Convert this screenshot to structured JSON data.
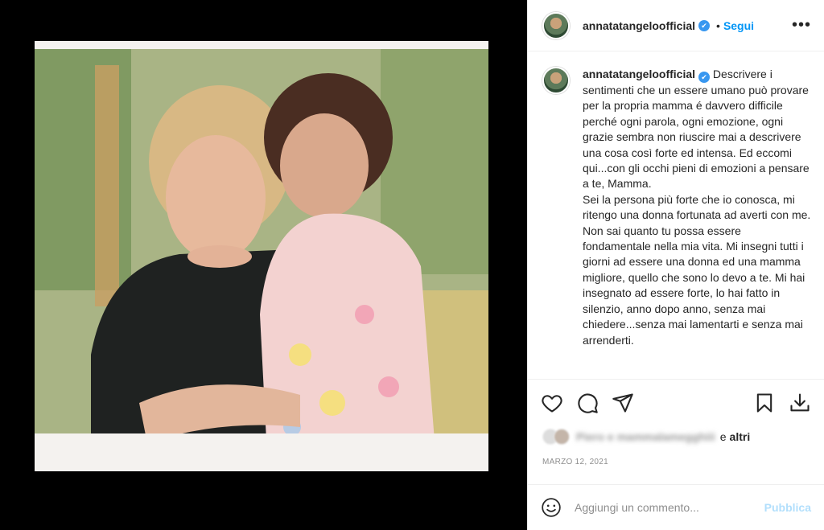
{
  "post": {
    "username": "annatatangeloofficial",
    "verified_mark": "✔",
    "dot": "•",
    "follow_label": "Segui",
    "more_label": "•••",
    "caption": "Descrivere i sentimenti che un essere umano può provare per la propria mamma é davvero difficile perché ogni parola, ogni emozione, ogni grazie sembra non riuscire mai a descrivere una cosa così forte ed intensa. Ed eccomi qui...con gli occhi pieni di emozioni a pensare a te, Mamma.\nSei la persona più forte che io conosca, mi ritengo una donna fortunata ad averti con me. Non sai quanto tu possa essere fondamentale nella mia vita. Mi insegni tutti i giorni ad essere una donna ed una mamma migliore, quello che sono lo devo a te. Mi hai insegnato ad essere forte, lo hai fatto in silenzio, anno dopo anno, senza mai chiedere...senza mai lamentarti e senza mai arrenderti."
  },
  "likes": {
    "blurred_names": "Piero e mammalamegghiii",
    "and_label": "e",
    "others_label": "altri"
  },
  "date": "MARZO 12, 2021",
  "comment": {
    "placeholder": "Aggiungi un commento...",
    "publish_label": "Pubblica"
  },
  "icons": {
    "like": "heart-icon",
    "comment": "comment-icon",
    "share": "send-icon",
    "save": "bookmark-icon",
    "download": "download-icon",
    "emoji": "smiley-icon"
  },
  "colors": {
    "accent": "#0095f6",
    "verified": "#3897f0",
    "publish_disabled": "#b2dffc"
  }
}
